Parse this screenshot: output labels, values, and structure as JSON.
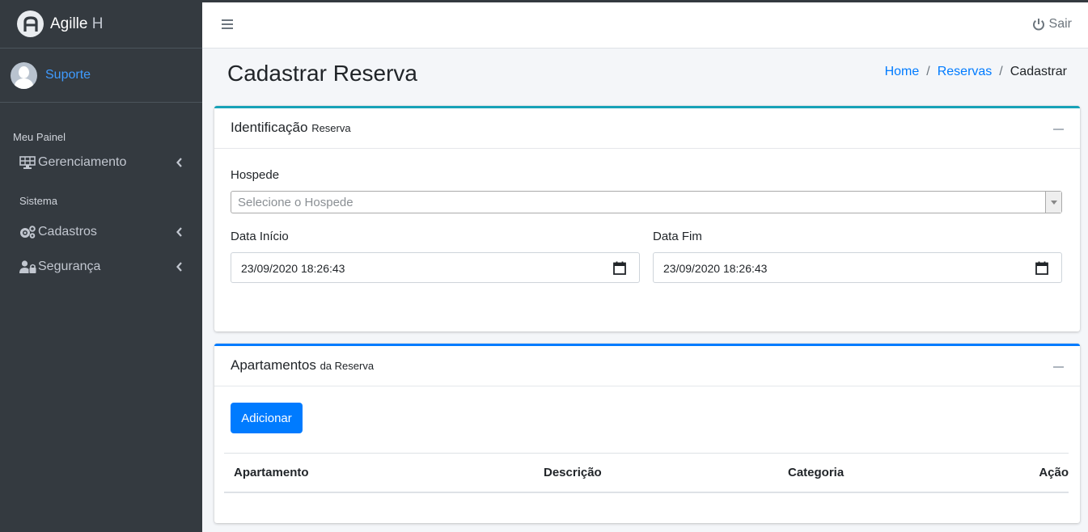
{
  "brand": {
    "name": "Agille",
    "suffix": "H"
  },
  "user": {
    "name": "Suporte"
  },
  "sidebar": {
    "header_panel": "Meu Painel",
    "header_system": "Sistema",
    "items": [
      {
        "label": "Gerenciamento",
        "icon": "solar-panel-icon"
      },
      {
        "label": "Cadastros",
        "icon": "cogs-icon"
      },
      {
        "label": "Segurança",
        "icon": "user-lock-icon"
      }
    ]
  },
  "navbar": {
    "logout_label": "Sair"
  },
  "page": {
    "title": "Cadastrar Reserva",
    "breadcrumb": [
      "Home",
      "Reservas",
      "Cadastrar"
    ]
  },
  "identificacao": {
    "title": "Identificação",
    "subtitle": "Reserva",
    "hospede_label": "Hospede",
    "hospede_placeholder": "Selecione o Hospede",
    "data_inicio_label": "Data Início",
    "data_inicio_value": "23/09/2020 18:26:43",
    "data_fim_label": "Data Fim",
    "data_fim_value": "23/09/2020 18:26:43"
  },
  "apartamentos": {
    "title": "Apartamentos",
    "subtitle": "da Reserva",
    "add_label": "Adicionar",
    "columns": [
      "Apartamento",
      "Descrição",
      "Categoria",
      "Ação"
    ]
  },
  "colors": {
    "sidebar_bg": "#343a40",
    "accent": "#007bff",
    "info": "#17a2b8"
  }
}
